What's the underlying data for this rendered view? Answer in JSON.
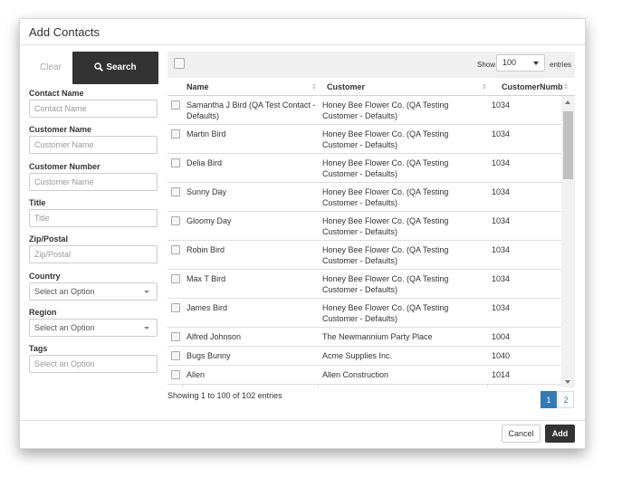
{
  "dialog": {
    "title": "Add Contacts"
  },
  "filters": {
    "clear_label": "Clear",
    "search_label": "Search",
    "fields": [
      {
        "label": "Contact Name",
        "placeholder": "Contact Name",
        "type": "text"
      },
      {
        "label": "Customer Name",
        "placeholder": "Customer Name",
        "type": "text"
      },
      {
        "label": "Customer Number",
        "placeholder": "Customer Name",
        "type": "text"
      },
      {
        "label": "Title",
        "placeholder": "Title",
        "type": "text"
      },
      {
        "label": "Zip/Postal",
        "placeholder": "Zip/Postal",
        "type": "text"
      },
      {
        "label": "Country",
        "placeholder": "Select an Option",
        "type": "select"
      },
      {
        "label": "Region",
        "placeholder": "Select an Option",
        "type": "select"
      },
      {
        "label": "Tags",
        "placeholder": "Select an Option",
        "type": "text"
      }
    ]
  },
  "table": {
    "show_label": "Show",
    "page_size": "100",
    "entries_label": "entries",
    "columns": [
      "Name",
      "Customer",
      "CustomerNumbe"
    ],
    "rows": [
      {
        "name": "Samantha J Bird (QA Test Contact - Defaults)",
        "customer": "Honey Bee Flower Co. (QA Testing Customer - Defaults)",
        "number": "1034"
      },
      {
        "name": "Martin Bird",
        "customer": "Honey Bee Flower Co. (QA Testing Customer - Defaults)",
        "number": "1034"
      },
      {
        "name": "Delia Bird",
        "customer": "Honey Bee Flower Co. (QA Testing Customer - Defaults)",
        "number": "1034"
      },
      {
        "name": "Sunny Day",
        "customer": "Honey Bee Flower Co. (QA Testing Customer - Defaults)",
        "number": "1034"
      },
      {
        "name": "Gloomy Day",
        "customer": "Honey Bee Flower Co. (QA Testing Customer - Defaults)",
        "number": "1034"
      },
      {
        "name": "Robin Bird",
        "customer": "Honey Bee Flower Co. (QA Testing Customer - Defaults)",
        "number": "1034"
      },
      {
        "name": "Max T Bird",
        "customer": "Honey Bee Flower Co. (QA Testing Customer - Defaults)",
        "number": "1034"
      },
      {
        "name": "James Bird",
        "customer": "Honey Bee Flower Co. (QA Testing Customer - Defaults)",
        "number": "1034"
      },
      {
        "name": "Alfred Johnson",
        "customer": "The Newmannium Party Place",
        "number": "1004"
      },
      {
        "name": "Bugs Bunny",
        "customer": "Acme Supplies Inc.",
        "number": "1040"
      },
      {
        "name": "Allen",
        "customer": "Allen Construction",
        "number": "1014"
      }
    ],
    "info": "Showing 1 to 100 of 102 entries",
    "pages": [
      "1",
      "2"
    ]
  },
  "footer": {
    "cancel_label": "Cancel",
    "add_label": "Add"
  },
  "colors": {
    "primary": "#337ab7",
    "dark_button": "#333333"
  }
}
